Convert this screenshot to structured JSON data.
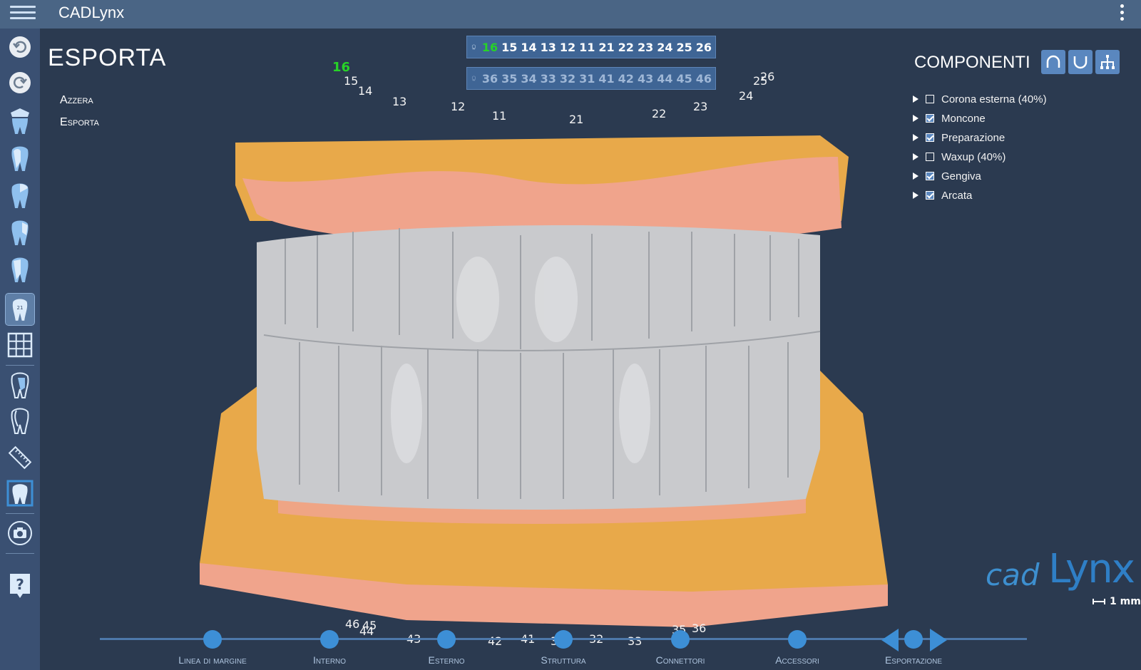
{
  "app": {
    "title": "CADLynx"
  },
  "panel": {
    "title": "ESPORTA",
    "links": [
      "Azzera",
      "Esporta"
    ]
  },
  "upper_teeth": [
    "16",
    "15",
    "14",
    "13",
    "12",
    "11",
    "21",
    "22",
    "23",
    "24",
    "25",
    "26"
  ],
  "upper_selected": "16",
  "lower_teeth": [
    "36",
    "35",
    "34",
    "33",
    "32",
    "31",
    "41",
    "42",
    "43",
    "44",
    "45",
    "46"
  ],
  "model_labels_upper": [
    "16",
    "15",
    "14",
    "13",
    "12",
    "11",
    "21",
    "22",
    "23",
    "24",
    "25",
    "26"
  ],
  "model_labels_lower": [
    "46",
    "45",
    "44",
    "43",
    "42",
    "41",
    "31",
    "32",
    "33",
    "35",
    "36"
  ],
  "components": {
    "title": "COMPONENTI",
    "items": [
      {
        "label": "Corona esterna (40%)",
        "checked": false
      },
      {
        "label": "Moncone",
        "checked": true
      },
      {
        "label": "Preparazione",
        "checked": true
      },
      {
        "label": "Waxup (40%)",
        "checked": false
      },
      {
        "label": "Gengiva",
        "checked": true
      },
      {
        "label": "Arcata",
        "checked": true
      }
    ]
  },
  "logo": {
    "cad": "cad",
    "lynx": "Lynx"
  },
  "scale_label": "1 mm",
  "workflow": {
    "steps": [
      "Linea di margine",
      "Interno",
      "Esterno",
      "Struttura",
      "Connettori",
      "Accessori",
      "Esportazione"
    ],
    "current": "Esportazione"
  },
  "colors": {
    "topbar": "#4a6585",
    "background": "#2b3a50",
    "sidebar": "#3a5072",
    "accent": "#3d8fd6",
    "selected_tooth": "#27d327",
    "gypsum": "#e8a94a",
    "gingiva": "#f0a48c",
    "teeth": "#c9cacd"
  },
  "icons": {
    "sidebar": [
      "undo-icon",
      "redo-icon",
      "crown-icon",
      "tooth-side-icon",
      "tooth-front-icon",
      "tooth-occlusal-icon",
      "tooth-cut-icon",
      "tooth-number-icon",
      "grid-icon",
      "tooth-section-icon",
      "tooth-outline-icon",
      "ruler-icon",
      "tooth-frame-icon",
      "camera-icon",
      "help-icon"
    ],
    "view": [
      "upper-arch-icon",
      "lower-arch-icon",
      "hierarchy-icon"
    ]
  }
}
